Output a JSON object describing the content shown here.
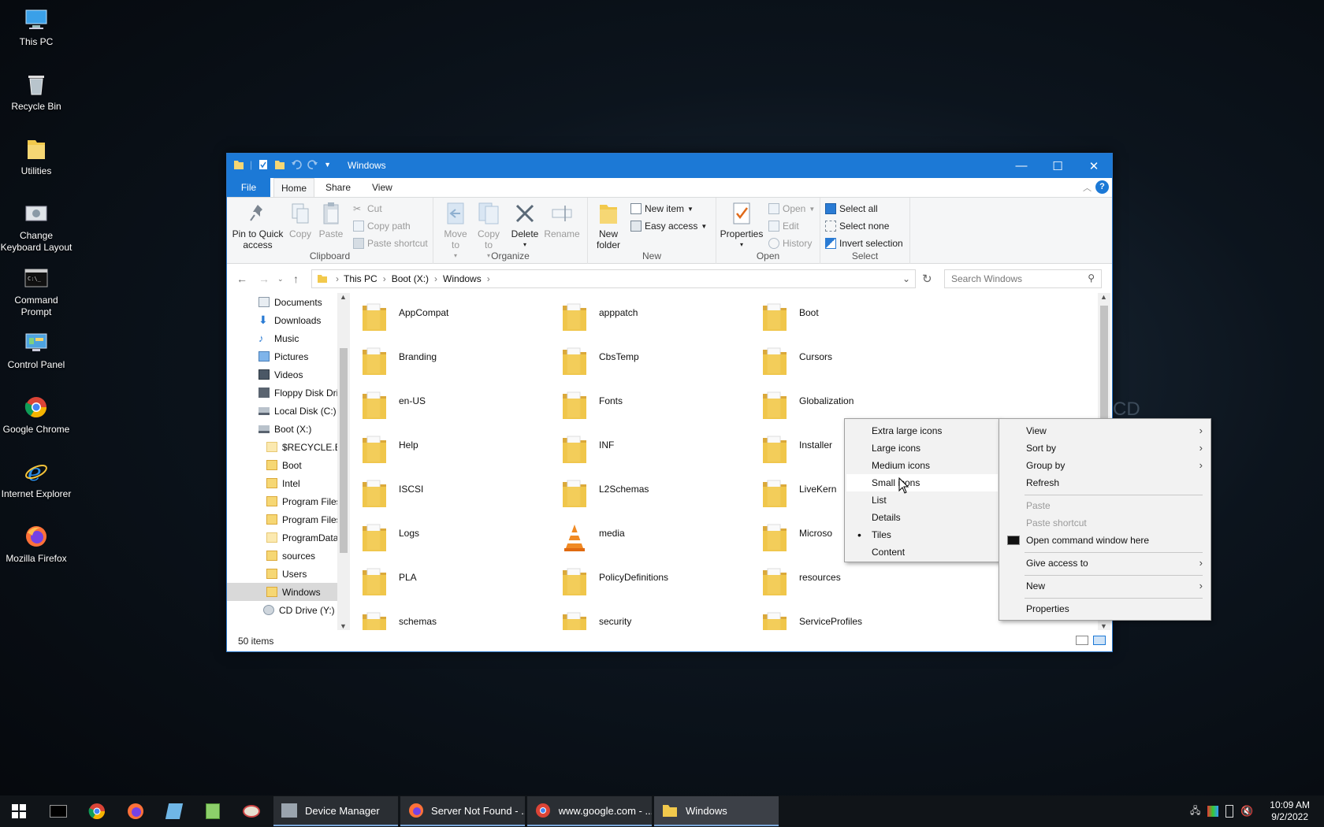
{
  "desktop": {
    "icons": [
      {
        "label": "This PC"
      },
      {
        "label": "Recycle Bin"
      },
      {
        "label": "Utilities"
      },
      {
        "label": "Change Keyboard Layout"
      },
      {
        "label": "Command Prompt"
      },
      {
        "label": "Control Panel"
      },
      {
        "label": "Google Chrome"
      },
      {
        "label": "Internet Explorer"
      },
      {
        "label": "Mozilla Firefox"
      }
    ]
  },
  "window": {
    "title": "Windows",
    "controls": {
      "minimize": "—",
      "maximize": "☐",
      "close": "✕"
    }
  },
  "ribbon": {
    "tabs": {
      "file": "File",
      "home": "Home",
      "share": "Share",
      "view": "View"
    },
    "clipboard": {
      "label": "Clipboard",
      "pin": "Pin to Quick access",
      "copy": "Copy",
      "paste": "Paste",
      "cut": "Cut",
      "copy_path": "Copy path",
      "paste_shortcut": "Paste shortcut"
    },
    "organize": {
      "label": "Organize",
      "move_to": "Move to",
      "copy_to": "Copy to",
      "delete": "Delete",
      "rename": "Rename"
    },
    "new": {
      "label": "New",
      "new_folder": "New folder",
      "new_item": "New item",
      "easy_access": "Easy access"
    },
    "open": {
      "label": "Open",
      "properties": "Properties",
      "open": "Open",
      "edit": "Edit",
      "history": "History"
    },
    "select": {
      "label": "Select",
      "select_all": "Select all",
      "select_none": "Select none",
      "invert": "Invert selection"
    }
  },
  "address": {
    "crumbs": [
      "This PC",
      "Boot (X:)",
      "Windows"
    ],
    "search_placeholder": "Search Windows"
  },
  "navpane": {
    "items": [
      {
        "label": "Documents",
        "icon": "documents-icon"
      },
      {
        "label": "Downloads",
        "icon": "downloads-icon"
      },
      {
        "label": "Music",
        "icon": "music-icon"
      },
      {
        "label": "Pictures",
        "icon": "pictures-icon"
      },
      {
        "label": "Videos",
        "icon": "videos-icon"
      },
      {
        "label": "Floppy Disk Dri",
        "icon": "floppy-icon"
      },
      {
        "label": "Local Disk (C:)",
        "icon": "drive-icon"
      },
      {
        "label": "Boot (X:)",
        "icon": "drive-icon"
      },
      {
        "label": "$RECYCLE.BIN",
        "icon": "folder-icon"
      },
      {
        "label": "Boot",
        "icon": "folder-icon"
      },
      {
        "label": "Intel",
        "icon": "folder-icon"
      },
      {
        "label": "Program Files",
        "icon": "folder-icon"
      },
      {
        "label": "Program Files",
        "icon": "folder-icon"
      },
      {
        "label": "ProgramData",
        "icon": "folder-icon"
      },
      {
        "label": "sources",
        "icon": "folder-icon"
      },
      {
        "label": "Users",
        "icon": "folder-icon"
      },
      {
        "label": "Windows",
        "icon": "folder-icon"
      },
      {
        "label": "CD Drive (Y:) H",
        "icon": "cd-icon"
      }
    ]
  },
  "folders": [
    "AppCompat",
    "apppatch",
    "Boot",
    "Branding",
    "CbsTemp",
    "Cursors",
    "en-US",
    "Fonts",
    "Globalization",
    "Help",
    "INF",
    "Installer",
    "ISCSI",
    "L2Schemas",
    "LiveKern",
    "Logs",
    "media",
    "Microso",
    "PLA",
    "PolicyDefinitions",
    "resources",
    "schemas",
    "security",
    "ServiceProfiles"
  ],
  "status": {
    "items": "50 items"
  },
  "context_menu": {
    "items": {
      "view": "View",
      "sort_by": "Sort by",
      "group_by": "Group by",
      "refresh": "Refresh",
      "paste": "Paste",
      "paste_shortcut": "Paste shortcut",
      "open_cmd": "Open command window here",
      "give_access": "Give access to",
      "new": "New",
      "properties": "Properties"
    }
  },
  "view_submenu": {
    "items": [
      "Extra large icons",
      "Large icons",
      "Medium icons",
      "Small icons",
      "List",
      "Details",
      "Tiles",
      "Content"
    ],
    "selected": "Tiles",
    "hovered": "Small icons"
  },
  "taskbar": {
    "buttons": [
      "Device Manager",
      "Server Not Found - ...",
      "www.google.com - ...",
      "Windows"
    ],
    "time": "10:09 AM",
    "date": "9/2/2022"
  },
  "colors": {
    "accent": "#1c79d6",
    "folder": "#f2c94c",
    "folder_dark": "#dba93a"
  }
}
